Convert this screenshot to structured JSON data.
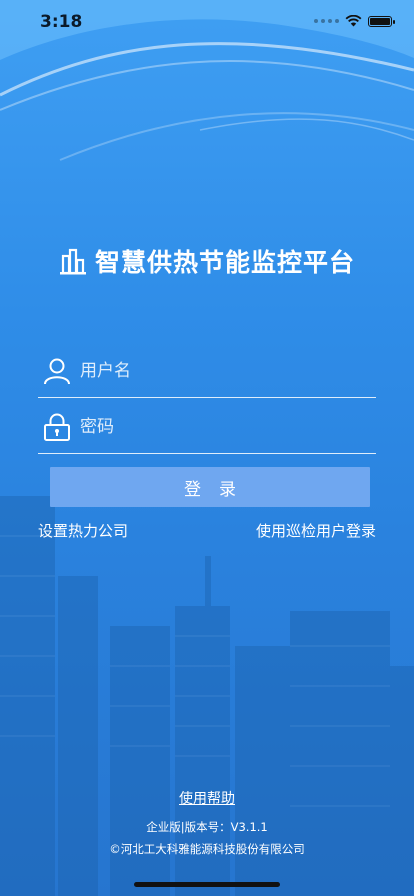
{
  "status_bar": {
    "time": "3:18"
  },
  "app": {
    "title": "智慧供热节能监控平台",
    "logo_icon": "city-building-icon"
  },
  "login_form": {
    "username": {
      "placeholder": "用户名",
      "value": "",
      "icon": "user-icon"
    },
    "password": {
      "placeholder": "密码",
      "value": "",
      "icon": "lock-icon"
    },
    "login_label": "登录"
  },
  "links": {
    "set_company": "设置热力公司",
    "patrol_login": "使用巡检用户登录"
  },
  "footer": {
    "help": "使用帮助",
    "version": "企业版|版本号：V3.1.1",
    "copyright": "©河北工大科雅能源科技股份有限公司"
  }
}
